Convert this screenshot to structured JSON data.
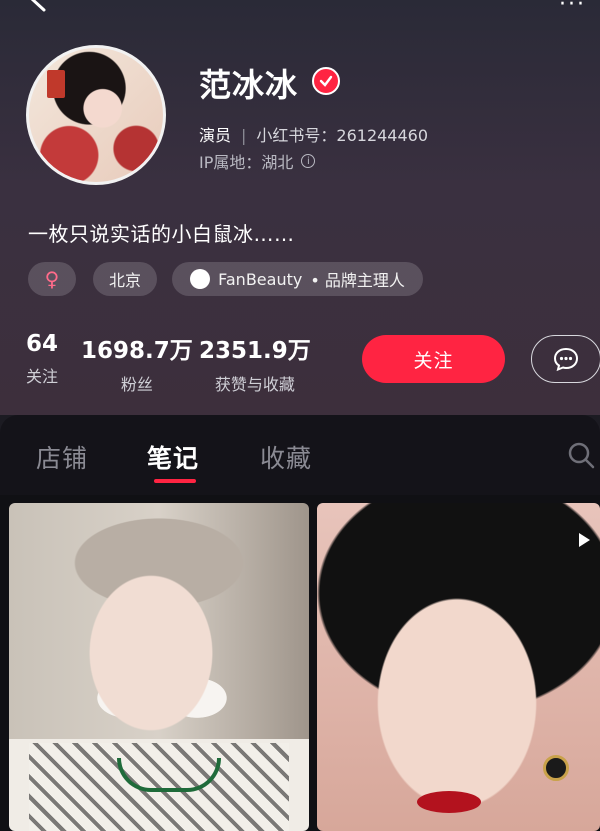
{
  "profile": {
    "name": "范冰冰",
    "role": "演员",
    "id_label": "小红书号：261244460",
    "ip_label": "IP属地：湖北",
    "bio": "一枚只说实话的小白鼠冰……"
  },
  "tags": {
    "gender": "♀",
    "city": "北京",
    "brand": "FanBeauty",
    "brand_title": "• 品牌主理人"
  },
  "stats": {
    "following": {
      "value": "64",
      "label": "关注"
    },
    "followers": {
      "value": "1698.7万",
      "label": "粉丝"
    },
    "likes": {
      "value": "2351.9万",
      "label": "获赞与收藏"
    }
  },
  "actions": {
    "follow_label": "关注"
  },
  "tabs": [
    {
      "label": "店铺"
    },
    {
      "label": "笔记"
    },
    {
      "label": "收藏"
    }
  ],
  "colors": {
    "accent": "#ff2442",
    "background": "#1c1b22",
    "header_gradient_end": "#3d2f3c"
  },
  "icons": [
    "back-arrow-icon",
    "more-icon",
    "verified-icon",
    "info-icon",
    "chat-icon",
    "search-icon",
    "video-play-icon"
  ]
}
